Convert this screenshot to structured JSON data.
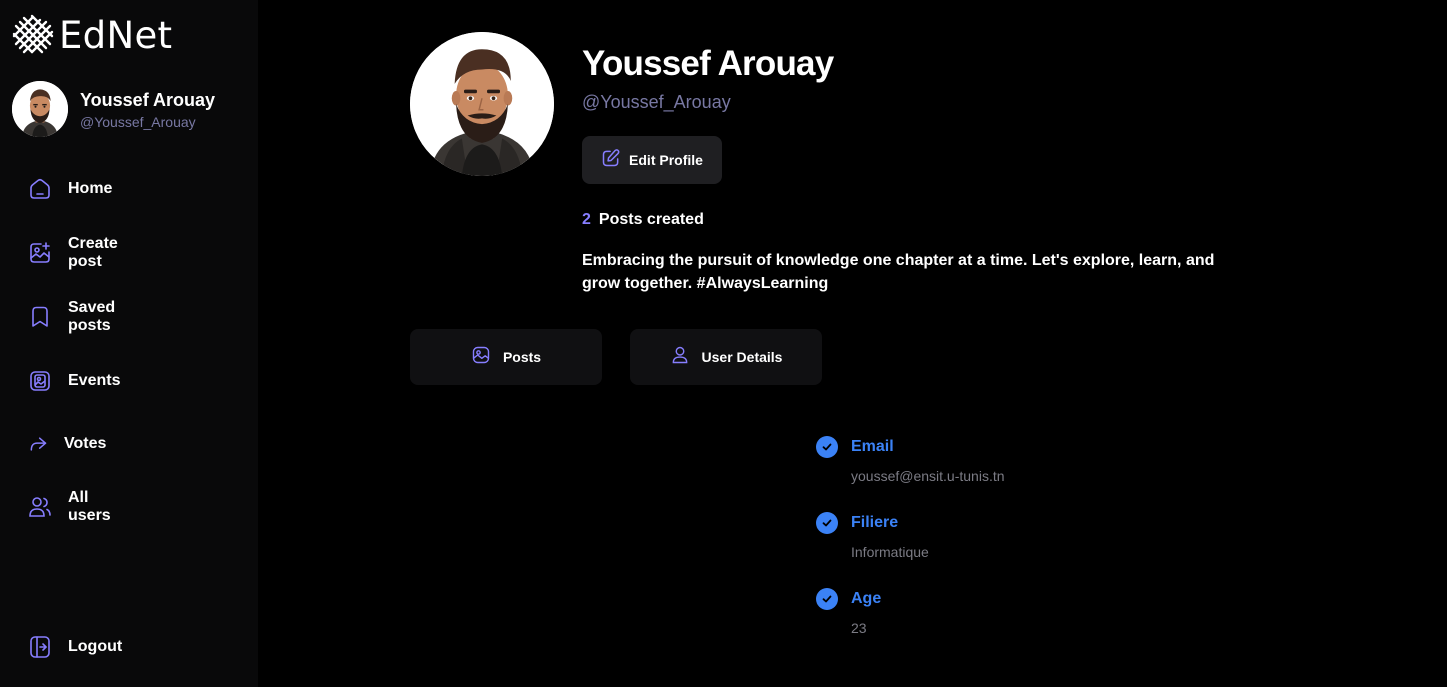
{
  "app": {
    "name": "EdNet"
  },
  "user": {
    "name": "Youssef Arouay",
    "handle": "@Youssef_Arouay"
  },
  "sidebar": {
    "items": [
      {
        "label": "Home",
        "icon": "home-icon"
      },
      {
        "label": "Create post",
        "icon": "create-post-icon"
      },
      {
        "label": "Saved posts",
        "icon": "bookmark-icon"
      },
      {
        "label": "Events",
        "icon": "events-icon"
      },
      {
        "label": "Votes",
        "icon": "share-arrow-icon"
      },
      {
        "label": "All users",
        "icon": "users-icon"
      }
    ],
    "logout_label": "Logout"
  },
  "profile": {
    "edit_label": "Edit Profile",
    "posts_count": "2",
    "posts_label": "Posts created",
    "bio": "Embracing the pursuit of knowledge one chapter at a time. Let's explore, learn, and grow together. #AlwaysLearning"
  },
  "tabs": [
    {
      "label": "Posts",
      "icon": "posts-image-icon"
    },
    {
      "label": "User Details",
      "icon": "user-icon"
    }
  ],
  "details": [
    {
      "title": "Email",
      "value": "youssef@ensit.u-tunis.tn"
    },
    {
      "title": "Filiere",
      "value": "Informatique"
    },
    {
      "title": "Age",
      "value": "23"
    }
  ],
  "colors": {
    "accent": "#877eff",
    "detail_blue": "#3b82f6",
    "muted": "#7878a3",
    "sidebar_bg": "#09090a",
    "button_bg": "#1f1f22"
  }
}
